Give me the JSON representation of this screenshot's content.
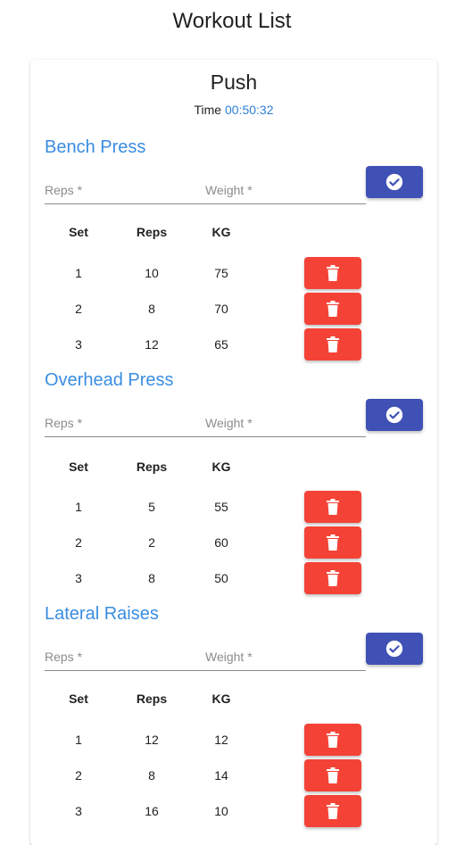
{
  "page": {
    "title": "Workout List"
  },
  "workout": {
    "name": "Push",
    "time_label": "Time",
    "time_value": "00:50:32"
  },
  "colors": {
    "accent_blue": "#3a8de0",
    "primary": "#3f51b5",
    "danger": "#f44336"
  },
  "table_headers": {
    "set": "Set",
    "reps": "Reps",
    "kg": "KG"
  },
  "fields": {
    "reps_label": "Reps *",
    "weight_label": "Weight *"
  },
  "icons": {
    "confirm": "check-circle-icon",
    "delete": "trash-icon"
  },
  "exercises": [
    {
      "name": "Bench Press",
      "sets": [
        {
          "set": "1",
          "reps": "10",
          "kg": "75"
        },
        {
          "set": "2",
          "reps": "8",
          "kg": "70"
        },
        {
          "set": "3",
          "reps": "12",
          "kg": "65"
        }
      ]
    },
    {
      "name": "Overhead Press",
      "sets": [
        {
          "set": "1",
          "reps": "5",
          "kg": "55"
        },
        {
          "set": "2",
          "reps": "2",
          "kg": "60"
        },
        {
          "set": "3",
          "reps": "8",
          "kg": "50"
        }
      ]
    },
    {
      "name": "Lateral Raises",
      "sets": [
        {
          "set": "1",
          "reps": "12",
          "kg": "12"
        },
        {
          "set": "2",
          "reps": "8",
          "kg": "14"
        },
        {
          "set": "3",
          "reps": "16",
          "kg": "10"
        }
      ]
    }
  ]
}
